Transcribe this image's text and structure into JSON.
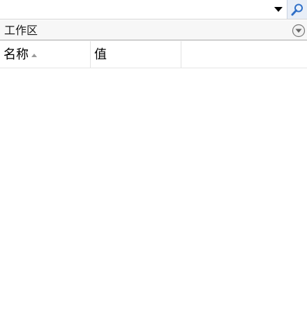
{
  "search": {
    "value": "",
    "placeholder": "",
    "dropdown_icon": "triangle-down-icon",
    "search_icon": "magnifier-icon",
    "search_button_color": "#2f6fc7"
  },
  "workspace": {
    "title": "工作区",
    "collapse_icon": "circle-chevron-down-icon"
  },
  "table": {
    "columns": [
      {
        "label": "名称",
        "sort": "ascending"
      },
      {
        "label": "值"
      }
    ],
    "rows": []
  }
}
